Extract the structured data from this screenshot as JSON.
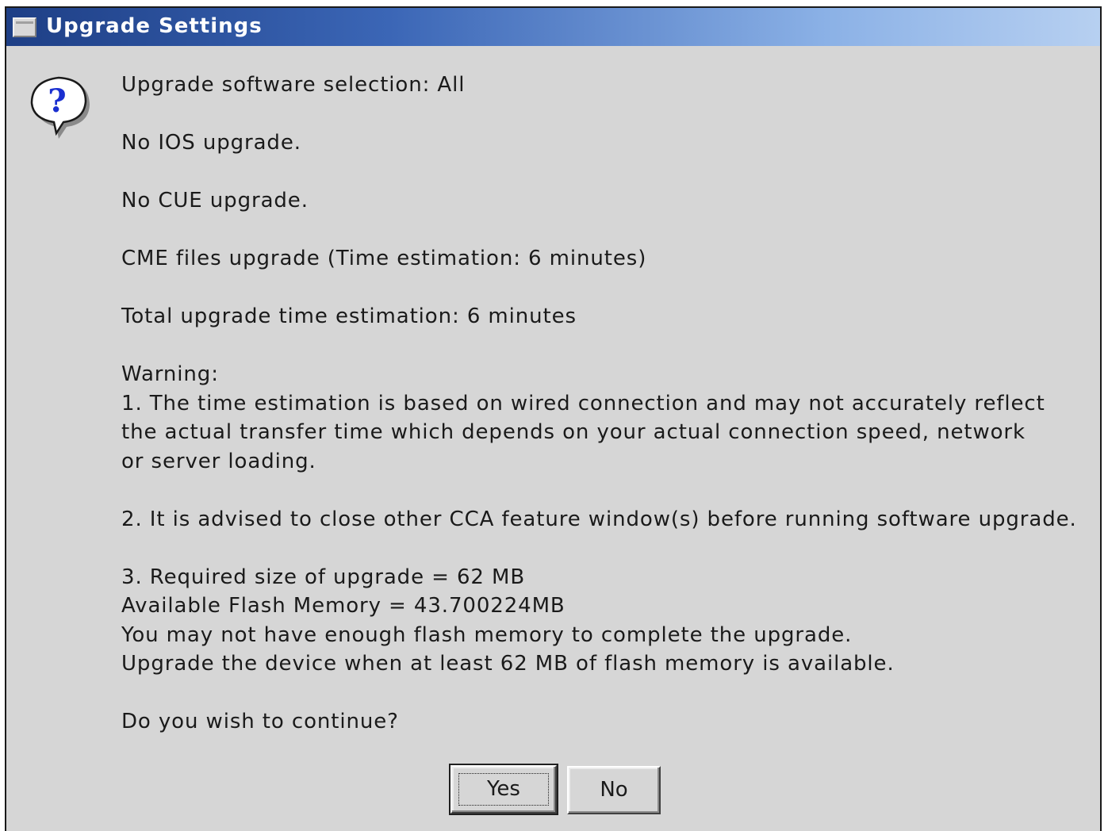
{
  "window": {
    "title": "Upgrade Settings"
  },
  "icons": {
    "title": "window-menu-icon",
    "message": "question-balloon-icon",
    "message_glyph": "?"
  },
  "colors": {
    "titlebar_start": "#1e3f86",
    "titlebar_end": "#b7d0f1",
    "dialog_background": "#d6d6d6",
    "icon_question_mark": "#1a2fd0"
  },
  "message": {
    "selection": "Upgrade software selection: All",
    "ios": "No IOS upgrade.",
    "cue": "No CUE upgrade.",
    "cme": "CME files upgrade (Time estimation: 6 minutes)",
    "total": "Total upgrade time estimation: 6 minutes",
    "warning_heading": "Warning:",
    "warning_1": [
      "1. The time estimation is based on wired connection and may not accurately reflect",
      "the actual transfer time which depends on your actual connection speed, network",
      "or server loading."
    ],
    "warning_2": "2. It is advised to close other CCA feature window(s) before running software upgrade.",
    "warning_3": [
      "3. Required size of upgrade = 62 MB",
      "Available Flash Memory = 43.700224MB",
      "You may not have enough flash memory to complete the upgrade.",
      "Upgrade the device when at least 62 MB of flash memory is available."
    ],
    "question": "Do you wish to continue?"
  },
  "buttons": {
    "yes": "Yes",
    "no": "No"
  }
}
